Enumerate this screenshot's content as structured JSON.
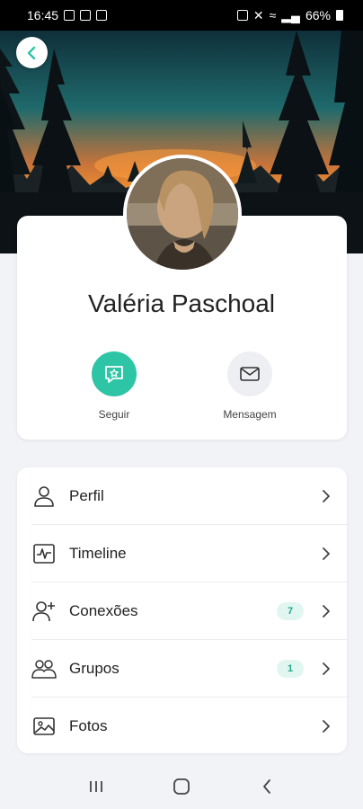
{
  "status_bar": {
    "time": "16:45",
    "battery": "66%"
  },
  "profile": {
    "name": "Valéria Paschoal"
  },
  "actions": {
    "follow_label": "Seguir",
    "message_label": "Mensagem"
  },
  "menu": {
    "items": [
      {
        "label": "Perfil",
        "icon": "user-icon",
        "badge": null
      },
      {
        "label": "Timeline",
        "icon": "activity-icon",
        "badge": null
      },
      {
        "label": "Conexões",
        "icon": "user-plus-icon",
        "badge": "7"
      },
      {
        "label": "Grupos",
        "icon": "users-icon",
        "badge": "1"
      },
      {
        "label": "Fotos",
        "icon": "image-icon",
        "badge": null
      }
    ]
  },
  "colors": {
    "accent": "#2ec4a6",
    "badge_bg": "#e2f6f1",
    "badge_text": "#1fa88a"
  }
}
